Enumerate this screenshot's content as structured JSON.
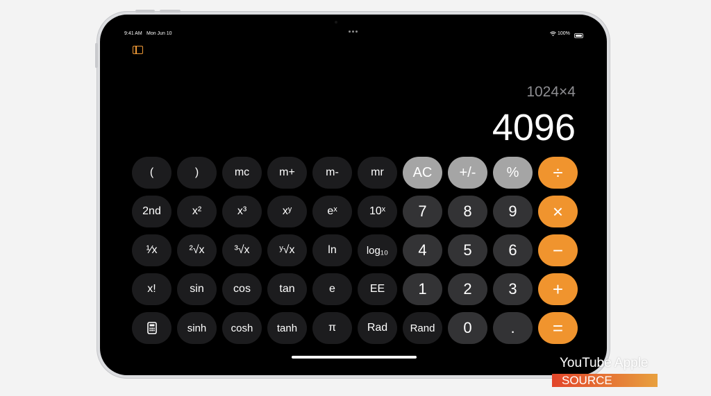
{
  "status_bar": {
    "time": "9:41 AM",
    "date": "Mon Jun 10",
    "battery": "100%"
  },
  "display": {
    "expression": "1024×4",
    "result": "4096"
  },
  "keys": [
    {
      "label": "(",
      "kind": "sci"
    },
    {
      "label": ")",
      "kind": "sci"
    },
    {
      "label": "mc",
      "kind": "sci"
    },
    {
      "label": "m+",
      "kind": "sci"
    },
    {
      "label": "m-",
      "kind": "sci"
    },
    {
      "label": "mr",
      "kind": "sci"
    },
    {
      "label": "AC",
      "kind": "util"
    },
    {
      "label": "+/-",
      "kind": "util"
    },
    {
      "label": "%",
      "kind": "util"
    },
    {
      "label": "÷",
      "kind": "op"
    },
    {
      "label": "2nd",
      "kind": "sci"
    },
    {
      "label": "x²",
      "kind": "sci"
    },
    {
      "label": "x³",
      "kind": "sci"
    },
    {
      "label": "xʸ",
      "kind": "sci"
    },
    {
      "label": "eˣ",
      "kind": "sci"
    },
    {
      "label": "10ˣ",
      "kind": "sci"
    },
    {
      "label": "7",
      "kind": "num"
    },
    {
      "label": "8",
      "kind": "num"
    },
    {
      "label": "9",
      "kind": "num"
    },
    {
      "label": "×",
      "kind": "op"
    },
    {
      "label": "¹⁄x",
      "kind": "sci"
    },
    {
      "label": "²√x",
      "kind": "sci"
    },
    {
      "label": "³√x",
      "kind": "sci"
    },
    {
      "label": "ʸ√x",
      "kind": "sci"
    },
    {
      "label": "ln",
      "kind": "sci"
    },
    {
      "label": "log₁₀",
      "kind": "sci"
    },
    {
      "label": "4",
      "kind": "num"
    },
    {
      "label": "5",
      "kind": "num"
    },
    {
      "label": "6",
      "kind": "num"
    },
    {
      "label": "−",
      "kind": "op"
    },
    {
      "label": "x!",
      "kind": "sci"
    },
    {
      "label": "sin",
      "kind": "sci"
    },
    {
      "label": "cos",
      "kind": "sci"
    },
    {
      "label": "tan",
      "kind": "sci"
    },
    {
      "label": "e",
      "kind": "sci"
    },
    {
      "label": "EE",
      "kind": "sci"
    },
    {
      "label": "1",
      "kind": "num"
    },
    {
      "label": "2",
      "kind": "num"
    },
    {
      "label": "3",
      "kind": "num"
    },
    {
      "label": "+",
      "kind": "op"
    },
    {
      "label": "",
      "kind": "sci",
      "icon": "calculator-icon"
    },
    {
      "label": "sinh",
      "kind": "sci"
    },
    {
      "label": "cosh",
      "kind": "sci"
    },
    {
      "label": "tanh",
      "kind": "sci"
    },
    {
      "label": "π",
      "kind": "sci"
    },
    {
      "label": "Rad",
      "kind": "sci"
    },
    {
      "label": "Rand",
      "kind": "sci"
    },
    {
      "label": "0",
      "kind": "num"
    },
    {
      "label": ".",
      "kind": "num"
    },
    {
      "label": "=",
      "kind": "op"
    }
  ],
  "watermark": {
    "line1": "YouTube Apple",
    "line2": "SOURCE"
  },
  "colors": {
    "operator": "#f0942e",
    "utility": "#a5a5a5",
    "number": "#333335",
    "scientific": "#1c1c1e",
    "sidebar_icon": "#f09a37"
  }
}
